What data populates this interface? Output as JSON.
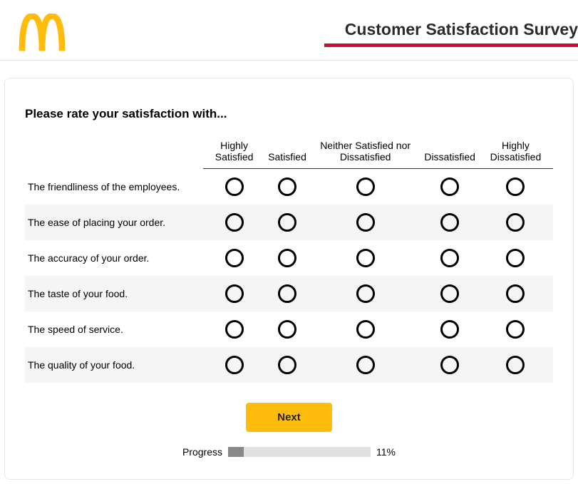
{
  "header": {
    "title": "Customer Satisfaction Survey"
  },
  "survey": {
    "prompt": "Please rate your satisfaction with...",
    "columns": [
      "Highly Satisfied",
      "Satisfied",
      "Neither Satisfied nor Dissatisfied",
      "Dissatisfied",
      "Highly Dissatisfied"
    ],
    "rows": [
      "The friendliness of the employees.",
      "The ease of placing your order.",
      "The accuracy of your order.",
      "The taste of your food.",
      "The speed of service.",
      "The quality of your food."
    ]
  },
  "controls": {
    "next_label": "Next",
    "progress_label": "Progress",
    "progress_percent_text": "11%",
    "progress_percent": 11
  },
  "colors": {
    "brand_yellow": "#ffbc0d",
    "brand_red": "#c8102e"
  }
}
